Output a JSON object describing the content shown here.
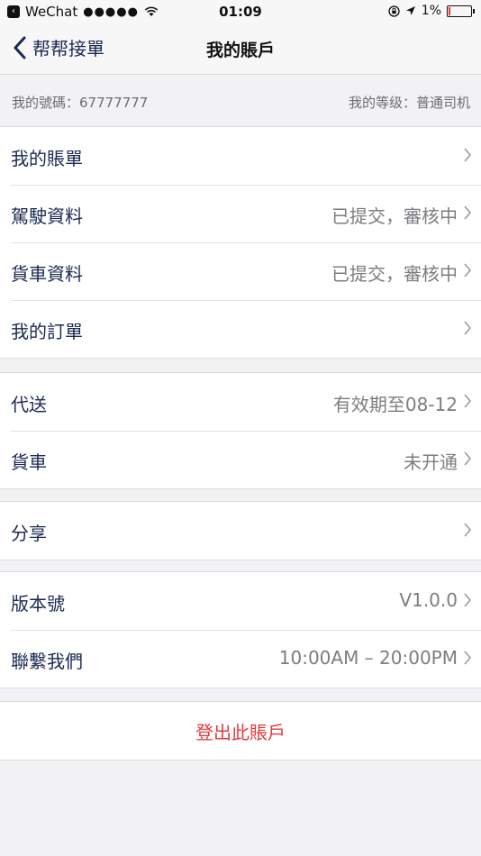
{
  "status_bar": {
    "carrier": "WeChat",
    "signal": "●●●●●",
    "time": "01:09",
    "battery": "1%"
  },
  "nav": {
    "back_label": "帮帮接單",
    "title": "我的賬戶"
  },
  "info": {
    "account_number": "我的號碼：67777777",
    "level": "我的等级：普通司机"
  },
  "groups": [
    {
      "rows": [
        {
          "label": "我的賬單",
          "value": ""
        },
        {
          "label": "駕駛資料",
          "value": "已提交，審核中"
        },
        {
          "label": "貨車資料",
          "value": "已提交，審核中"
        },
        {
          "label": "我的訂單",
          "value": ""
        }
      ]
    },
    {
      "rows": [
        {
          "label": "代送",
          "value": "有效期至08-12"
        },
        {
          "label": "貨車",
          "value": "未开通"
        }
      ]
    },
    {
      "rows": [
        {
          "label": "分享",
          "value": ""
        }
      ]
    },
    {
      "rows": [
        {
          "label": "版本號",
          "value": "V1.0.0"
        },
        {
          "label": "聯繫我們",
          "value": "10:00AM – 20:00PM"
        }
      ]
    }
  ],
  "logout_label": "登出此賬戶"
}
